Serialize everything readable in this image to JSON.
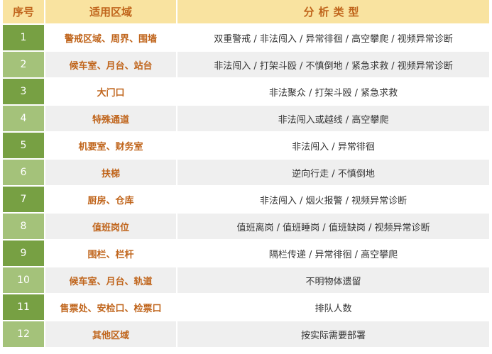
{
  "header": {
    "no": "序号",
    "area": "适用区域",
    "type": "分析类型"
  },
  "rows": [
    {
      "no": "1",
      "area": "警戒区域、周界、围墙",
      "type": "双重警戒 / 非法闯入 / 异常徘徊 / 高空攀爬 / 视频异常诊断"
    },
    {
      "no": "2",
      "area": "候车室、月台、站台",
      "type": "非法闯入 / 打架斗殴 / 不慎倒地 / 紧急求救 / 视频异常诊断"
    },
    {
      "no": "3",
      "area": "大门口",
      "type": "非法聚众 / 打架斗殴 / 紧急求救"
    },
    {
      "no": "4",
      "area": "特殊通道",
      "type": "非法闯入或越线 / 高空攀爬"
    },
    {
      "no": "5",
      "area": "机要室、财务室",
      "type": "非法闯入 / 异常徘徊"
    },
    {
      "no": "6",
      "area": "扶梯",
      "type": "逆向行走 / 不慎倒地"
    },
    {
      "no": "7",
      "area": "厨房、仓库",
      "type": "非法闯入 / 烟火报警 / 视频异常诊断"
    },
    {
      "no": "8",
      "area": "值班岗位",
      "type": "值班离岗 / 值班睡岗 / 值班缺岗 / 视频异常诊断"
    },
    {
      "no": "9",
      "area": "围栏、栏杆",
      "type": "隔栏传递 / 异常徘徊 / 高空攀爬"
    },
    {
      "no": "10",
      "area": "候车室、月台、轨道",
      "type": "不明物体遗留"
    },
    {
      "no": "11",
      "area": "售票处、安检口、检票口",
      "type": "排队人数"
    },
    {
      "no": "12",
      "area": "其他区域",
      "type": "按实际需要部署"
    }
  ]
}
